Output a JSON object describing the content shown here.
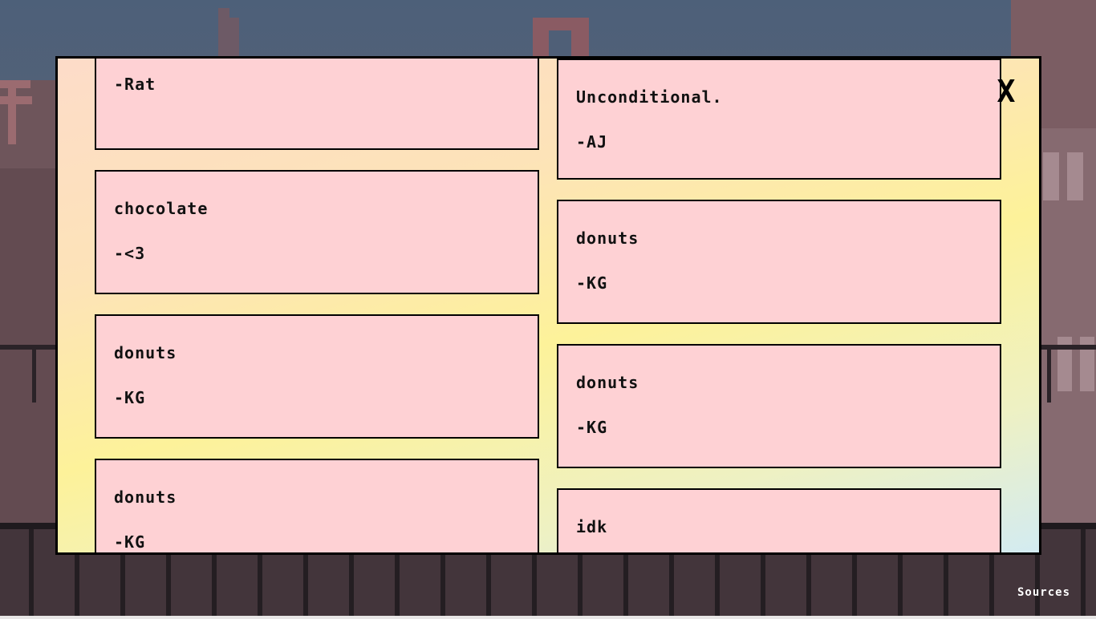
{
  "modal": {
    "close_label": "X",
    "left_notes": [
      {
        "message": "",
        "signature": "-Rat"
      },
      {
        "message": "chocolate",
        "signature": "-<3"
      },
      {
        "message": "donuts",
        "signature": "-KG"
      },
      {
        "message": "donuts",
        "signature": "-KG"
      }
    ],
    "right_notes": [
      {
        "message": "Unconditional.",
        "signature": "-AJ"
      },
      {
        "message": "donuts",
        "signature": "-KG"
      },
      {
        "message": "donuts",
        "signature": "-KG"
      },
      {
        "message": "idk",
        "signature": ""
      }
    ]
  },
  "footer": {
    "sources_label": "Sources"
  },
  "colors": {
    "note_background": "#fed1d4",
    "border": "#000000"
  }
}
